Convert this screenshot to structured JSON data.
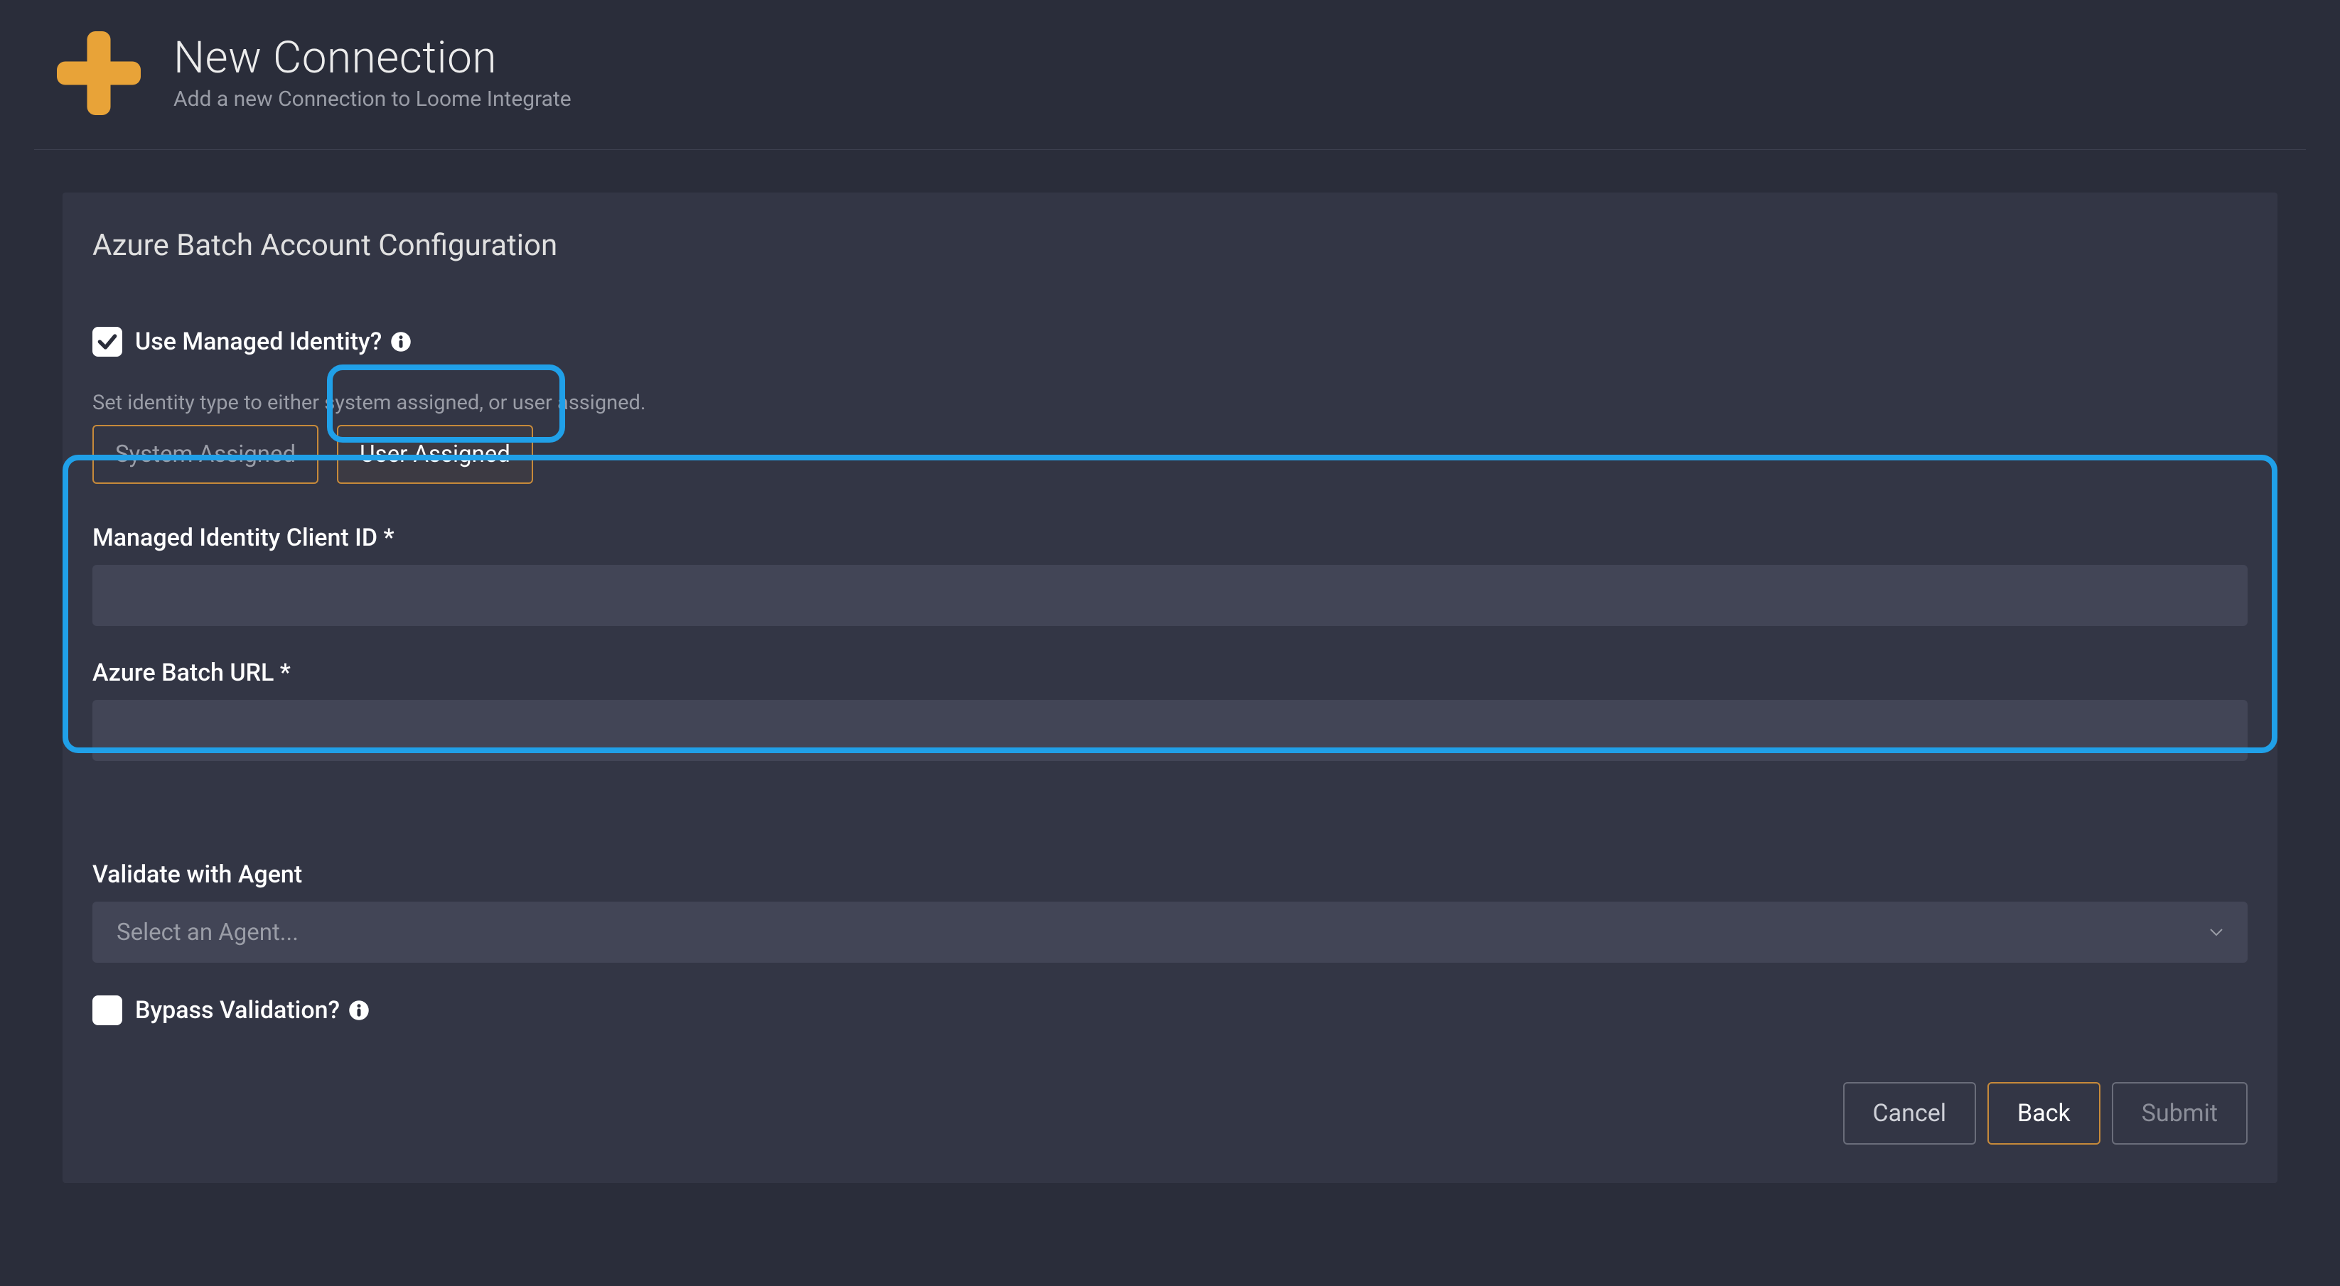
{
  "header": {
    "title": "New Connection",
    "subtitle": "Add a new Connection to Loome Integrate"
  },
  "card": {
    "title": "Azure Batch Account Configuration",
    "use_managed_identity_label": "Use Managed Identity?",
    "identity_helper": "Set identity type to either system assigned, or user assigned.",
    "toggle_system": "System Assigned",
    "toggle_user": "User Assigned",
    "client_id_label": "Managed Identity Client ID *",
    "batch_url_label": "Azure Batch URL *",
    "validate_label": "Validate with Agent",
    "validate_placeholder": "Select an Agent...",
    "bypass_label": "Bypass Validation?"
  },
  "buttons": {
    "cancel": "Cancel",
    "back": "Back",
    "submit": "Submit"
  }
}
